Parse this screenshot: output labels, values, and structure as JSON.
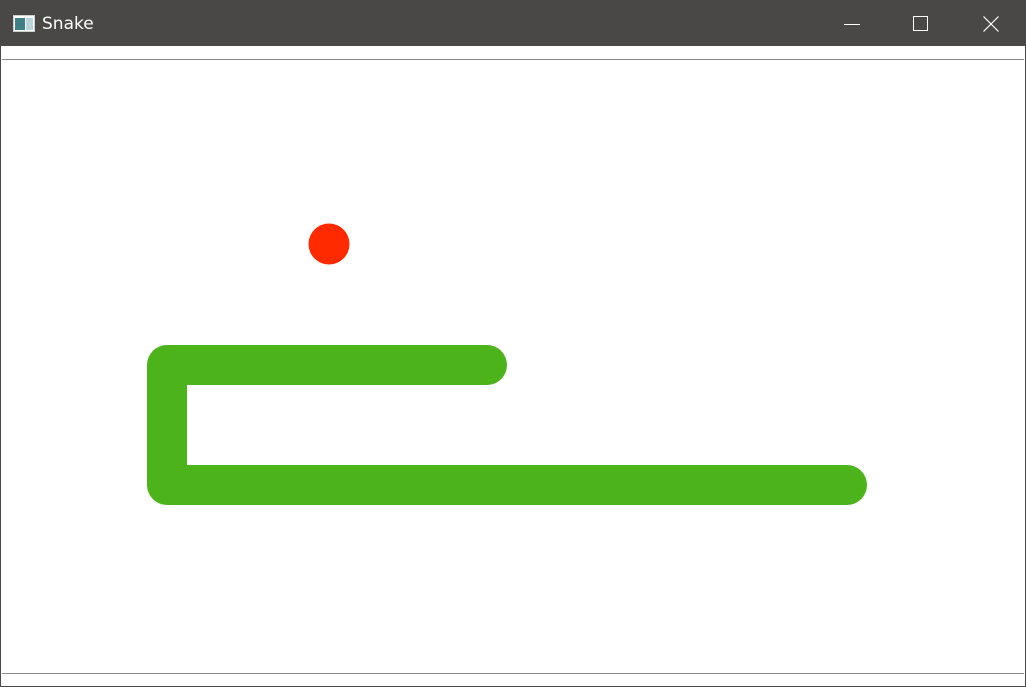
{
  "window": {
    "title": "Snake",
    "titlebar_color": "#4a4846",
    "icons": {
      "app": "window-app-icon",
      "minimize": "minimize-icon",
      "maximize": "maximize-icon",
      "close": "close-icon"
    }
  },
  "game": {
    "grid_cell_size": 40,
    "food": {
      "color": "#ff2a00",
      "cell": [
        8,
        4
      ]
    },
    "snake": {
      "color": "#4cb31b",
      "segments": [
        [
          12,
          7
        ],
        [
          4,
          7
        ],
        [
          4,
          10
        ],
        [
          21,
          10
        ]
      ]
    }
  }
}
